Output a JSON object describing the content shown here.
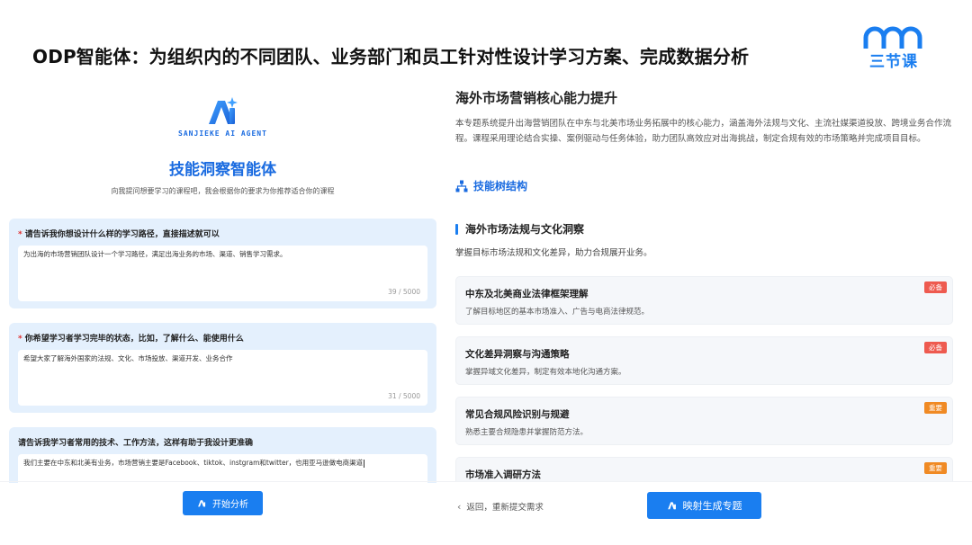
{
  "header": {
    "headline": "ODP智能体：为组织内的不同团队、业务部门和员工针对性设计学习方案、完成数据分析",
    "brand_name": "三节课"
  },
  "agent": {
    "logo_text": "Ai",
    "subtitle": "SANJIEKE AI AGENT",
    "title": "技能洞察智能体",
    "description": "向我提问想要学习的课程吧，我会根据你的要求为你推荐适合你的课程"
  },
  "questions": [
    {
      "label": "请告诉我你想设计什么样的学习路径，直接描述就可以",
      "required": "*",
      "answer": "为出海的市场营销团队设计一个学习路径，满足出海业务的市场、渠道、销售学习需求。",
      "count": "39 / 5000"
    },
    {
      "label": "你希望学习者学习完毕的状态，比如，了解什么、能使用什么",
      "required": "*",
      "answer": "希望大家了解海外国家的法规、文化、市场投放、渠道开发、业务合作",
      "count": "31 / 5000"
    },
    {
      "label": "请告诉我学习者常用的技术、工作方法，这样有助于我设计更准确",
      "required": "",
      "answer": "我们主要在中东和北美有业务，市场营销主要是Facebook、tiktok、instgram和twitter，也用亚马逊做电商渠道",
      "count": ""
    }
  ],
  "start_button": {
    "label": "开始分析"
  },
  "topic": {
    "title": "海外市场营销核心能力提升",
    "description": "本专题系统提升出海营销团队在中东与北美市场业务拓展中的核心能力，涵盖海外法规与文化、主流社媒渠道投放、跨境业务合作流程。课程采用理论结合实操、案例驱动与任务体验，助力团队高效应对出海挑战，制定合规有效的市场策略并完成项目目标。",
    "tree_link": "技能树结构"
  },
  "section": {
    "title": "海外市场法规与文化洞察",
    "description": "掌握目标市场法规和文化差异，助力合规展开业务。",
    "courses": [
      {
        "title": "中东及北美商业法律框架理解",
        "desc": "了解目标地区的基本市场准入、广告与电商法律规范。",
        "tag": "必备",
        "tag_color": "#ee5a4f"
      },
      {
        "title": "文化差异洞察与沟通策略",
        "desc": "掌握异域文化差异，制定有效本地化沟通方案。",
        "tag": "必备",
        "tag_color": "#ee5a4f"
      },
      {
        "title": "常见合规风险识别与规避",
        "desc": "熟悉主要合规隐患并掌握防范方法。",
        "tag": "重要",
        "tag_color": "#f08a24"
      },
      {
        "title": "市场准入调研方法",
        "desc": "",
        "tag": "重要",
        "tag_color": "#f08a24"
      }
    ]
  },
  "footer": {
    "back_label": "返回，重新提交需求",
    "generate_label": "映射生成专题"
  },
  "colors": {
    "accent": "#1a7ef0",
    "card_bg": "#e4f0fd",
    "must_tag": "#ee5a4f",
    "important_tag": "#f08a24"
  }
}
